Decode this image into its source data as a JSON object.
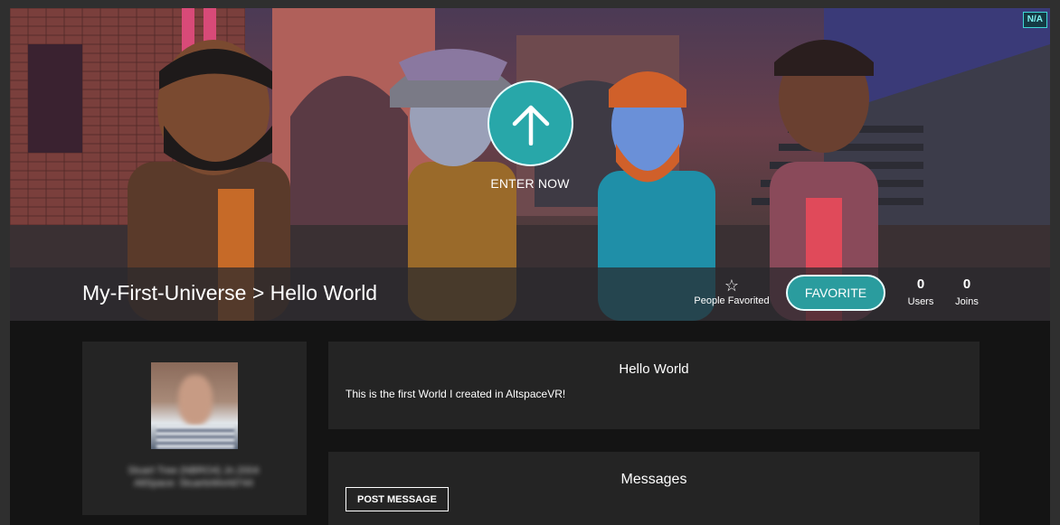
{
  "hero": {
    "badge": "N/A",
    "enter_label": "ENTER NOW",
    "title": "My-First-Universe > Hello World",
    "favorited_label": "People Favorited",
    "favorite_button": "FAVORITE",
    "stats": [
      {
        "value": "0",
        "label": "Users"
      },
      {
        "value": "0",
        "label": "Joins"
      }
    ]
  },
  "owner": {
    "name_line1": "Stuart Tree (NBRO4) Jn.2004",
    "name_line2": "AltSpace: StuartsWorld744"
  },
  "description": {
    "title": "Hello World",
    "text": "This is the first World I created in AltspaceVR!"
  },
  "messages": {
    "title": "Messages",
    "post_button": "POST MESSAGE"
  },
  "icons": {
    "enter": "arrow-up-icon",
    "favorite": "star-outline-icon"
  },
  "colors": {
    "accent": "#2a9c9e",
    "background": "#141414",
    "panel": "#242424"
  }
}
